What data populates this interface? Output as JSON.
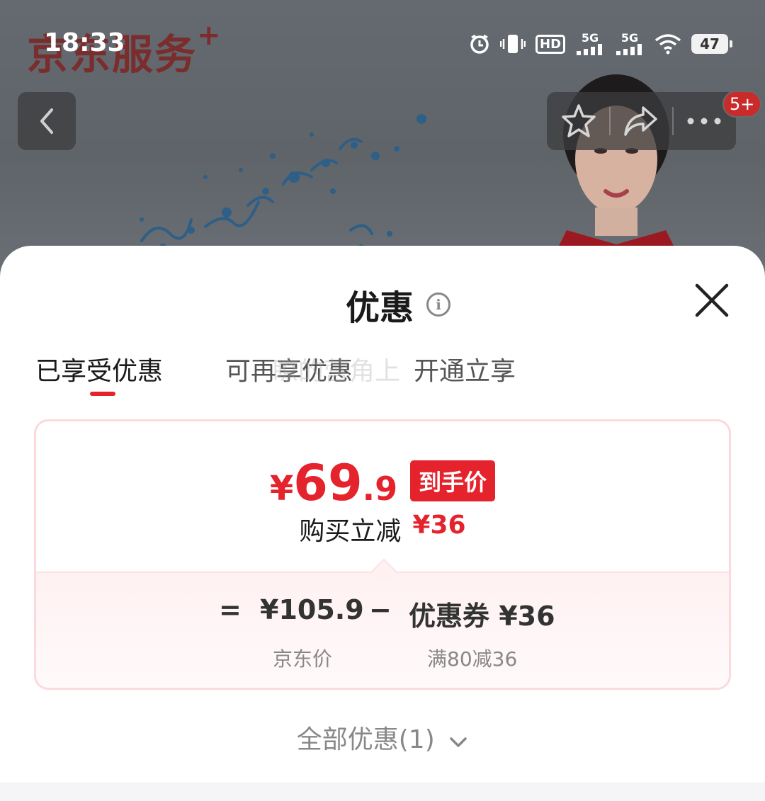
{
  "status_bar": {
    "time": "18:33",
    "hd_label": "HD",
    "sim1_label": "5G",
    "sim2_label": "5G",
    "battery": "47"
  },
  "hero": {
    "brand_text": "京东服务",
    "brand_plus": "+"
  },
  "nav": {
    "badge": "5+"
  },
  "sheet": {
    "title": "优惠",
    "tabs": [
      "已享受优惠",
      "可再享优惠",
      "开通立享"
    ],
    "tab_overlay_text": "瞭的营角上",
    "final_price": {
      "currency": "¥",
      "integer": "69",
      "decimal": ".9",
      "tag": "到手价"
    },
    "save": {
      "label": "购买立减",
      "amount": "¥36"
    },
    "formula": {
      "equals": "=",
      "jd_price": "¥105.9",
      "minus": "−",
      "coupon": "优惠券 ¥36",
      "jd_price_label": "京东价",
      "coupon_label": "满80减36"
    },
    "all_offers": "全部优惠(1)"
  },
  "colors": {
    "accent": "#e4232d",
    "card_border": "#fbd9dd",
    "muted_text": "#888888"
  },
  "icons": [
    "back-arrow-icon",
    "star-icon",
    "share-icon",
    "more-icon",
    "info-icon",
    "close-icon",
    "chevron-down-icon",
    "alarm-icon",
    "vibrate-icon",
    "wifi-icon",
    "battery-icon"
  ]
}
